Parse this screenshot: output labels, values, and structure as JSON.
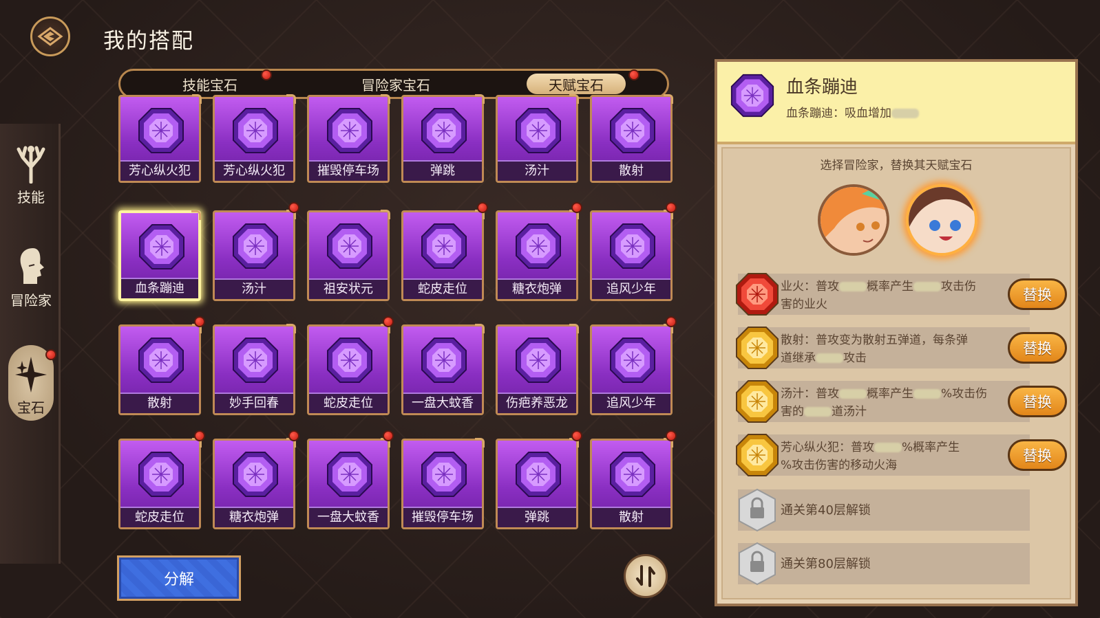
{
  "page": {
    "title": "我的搭配"
  },
  "sidebar": {
    "items": [
      {
        "label": "技能",
        "icon": "skill-tree-icon",
        "active": false
      },
      {
        "label": "冒险家",
        "icon": "adventurer-silhouette-icon",
        "active": false
      },
      {
        "label": "宝石",
        "icon": "gem-sparkle-icon",
        "active": true,
        "badge": true
      }
    ]
  },
  "tabs": [
    {
      "label": "技能宝石",
      "active": false,
      "badge": true
    },
    {
      "label": "冒险家宝石",
      "active": false,
      "badge": false
    },
    {
      "label": "天赋宝石",
      "active": true,
      "badge": true
    }
  ],
  "gems": [
    {
      "name": "芳心纵火犯",
      "badge": false,
      "selected": false
    },
    {
      "name": "芳心纵火犯",
      "badge": false,
      "selected": false
    },
    {
      "name": "摧毁停车场",
      "badge": false,
      "selected": false
    },
    {
      "name": "弹跳",
      "badge": false,
      "selected": false
    },
    {
      "name": "汤汁",
      "badge": false,
      "selected": false
    },
    {
      "name": "散射",
      "badge": false,
      "selected": false
    },
    {
      "name": "血条蹦迪",
      "badge": false,
      "selected": true
    },
    {
      "name": "汤汁",
      "badge": true,
      "selected": false
    },
    {
      "name": "祖安状元",
      "badge": false,
      "selected": false
    },
    {
      "name": "蛇皮走位",
      "badge": true,
      "selected": false
    },
    {
      "name": "糖衣炮弹",
      "badge": true,
      "selected": false
    },
    {
      "name": "追风少年",
      "badge": true,
      "selected": false
    },
    {
      "name": "散射",
      "badge": true,
      "selected": false
    },
    {
      "name": "妙手回春",
      "badge": false,
      "selected": false
    },
    {
      "name": "蛇皮走位",
      "badge": true,
      "selected": false
    },
    {
      "name": "一盘大蚊香",
      "badge": false,
      "selected": false
    },
    {
      "name": "伤疤养恶龙",
      "badge": false,
      "selected": false
    },
    {
      "name": "追风少年",
      "badge": true,
      "selected": false
    },
    {
      "name": "蛇皮走位",
      "badge": true,
      "selected": false
    },
    {
      "name": "糖衣炮弹",
      "badge": true,
      "selected": false
    },
    {
      "name": "一盘大蚊香",
      "badge": true,
      "selected": false
    },
    {
      "name": "摧毁停车场",
      "badge": false,
      "selected": false
    },
    {
      "name": "弹跳",
      "badge": true,
      "selected": false
    },
    {
      "name": "散射",
      "badge": true,
      "selected": false
    }
  ],
  "buttons": {
    "decompose": "分解"
  },
  "detail": {
    "title": "血条蹦迪",
    "desc": "血条蹦迪：吸血增加"
  },
  "selector": {
    "hint": "选择冒险家，替换其天赋宝石",
    "avatars": [
      {
        "name": "orange-hair-adventurer",
        "selected": false
      },
      {
        "name": "brown-hair-adventurer",
        "selected": true
      }
    ]
  },
  "slots": [
    {
      "gem_color": "red",
      "line1": "业火：普攻",
      "line1b": "概率产生",
      "line1c": "攻击伤",
      "line2": "害的业火",
      "button": "替换"
    },
    {
      "gem_color": "gold",
      "line1": "散射：普攻变为散射五弹道，每条弹",
      "line1b": "",
      "line1c": "",
      "line2": "道继承",
      "line2b": "攻击",
      "button": "替换"
    },
    {
      "gem_color": "gold",
      "line1": "汤汁：普攻",
      "line1b": "概率产生",
      "line1c": "%攻击伤",
      "line2": "害的",
      "line2b": "道汤汁",
      "button": "替换"
    },
    {
      "gem_color": "gold",
      "line1": "芳心纵火犯：普攻",
      "line1b": "%概率产生",
      "line1c": "",
      "line2": "%攻击伤害的移动火海",
      "button": "替换"
    }
  ],
  "locks": [
    {
      "label": "通关第40层解锁"
    },
    {
      "label": "通关第80层解锁"
    }
  ],
  "colors": {
    "gem_purple": "#b04ae8",
    "badge_red": "#e0281a",
    "replace_orange": "#f0a030",
    "decompose_blue": "#3f6fe0"
  }
}
